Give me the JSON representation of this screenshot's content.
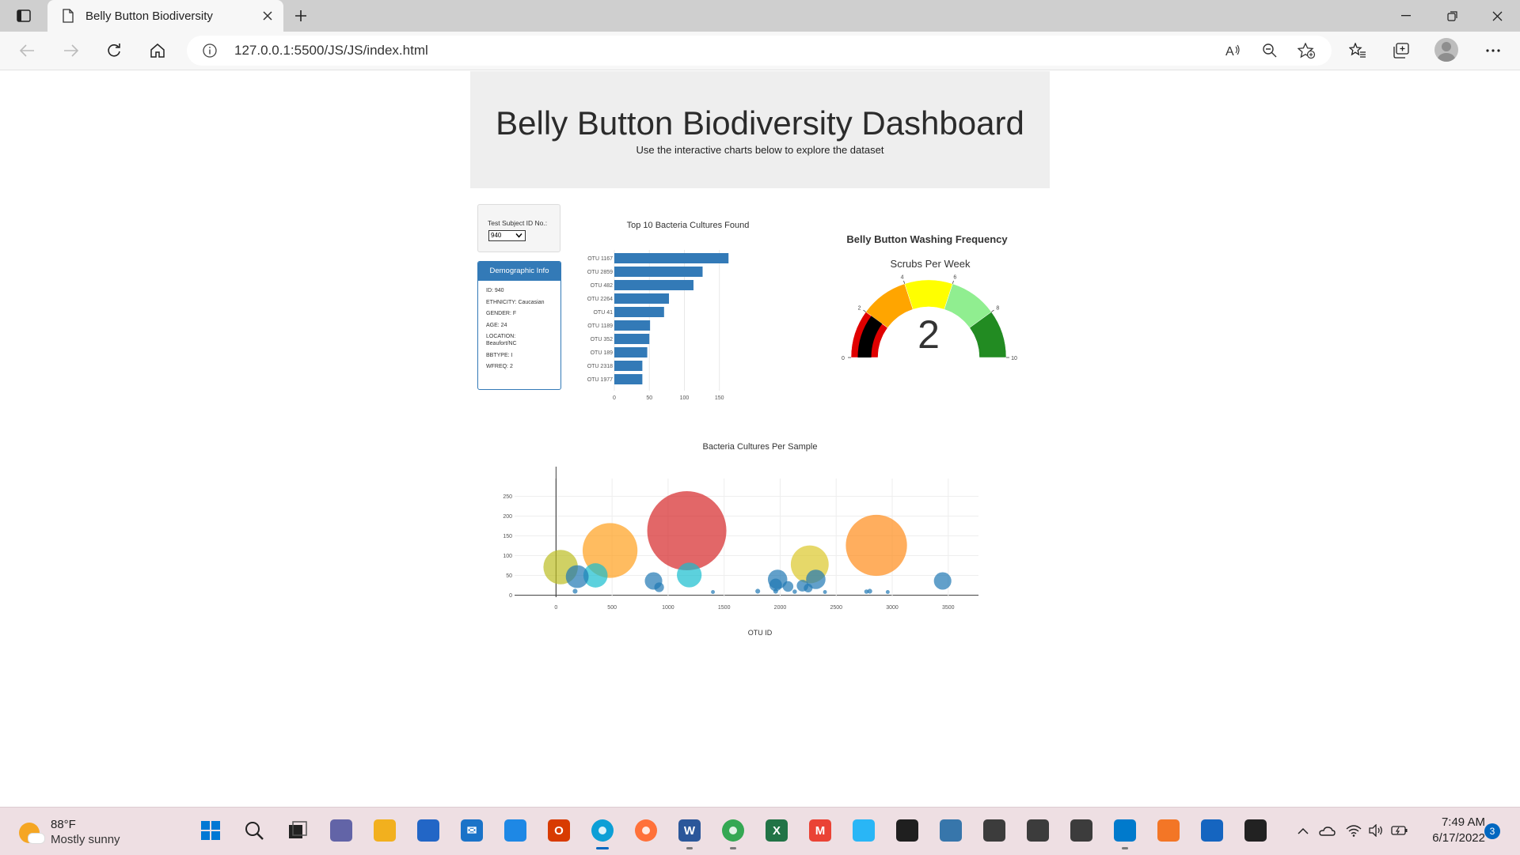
{
  "browser": {
    "tab_title": "Belly Button Biodiversity",
    "url_host": "127.0.0.1",
    "url_rest": ":5500/JS/JS/index.html"
  },
  "page": {
    "title": "Belly Button Biodiversity Dashboard",
    "subtitle": "Use the interactive charts below to explore the dataset",
    "select_label": "Test Subject ID No.:",
    "selected_id": "940",
    "demo_header": "Demographic Info",
    "demo_rows": [
      "ID: 940",
      "ETHNICITY: Caucasian",
      "GENDER: F",
      "AGE: 24",
      "LOCATION: Beaufort/NC",
      "BBTYPE: I",
      "WFREQ: 2"
    ]
  },
  "chart_data": [
    {
      "type": "bar",
      "orientation": "horizontal",
      "title": "Top 10 Bacteria Cultures Found",
      "categories": [
        "OTU 1167",
        "OTU 2859",
        "OTU 482",
        "OTU 2264",
        "OTU 41",
        "OTU 1189",
        "OTU 352",
        "OTU 189",
        "OTU 2318",
        "OTU 1977"
      ],
      "values": [
        163,
        126,
        113,
        78,
        71,
        51,
        50,
        47,
        40,
        40
      ],
      "xticks": [
        0,
        50,
        100,
        150
      ],
      "xlim": [
        0,
        165
      ],
      "color": "#337ab7"
    },
    {
      "type": "gauge",
      "title": "Belly Button Washing Frequency",
      "subtitle": "Scrubs Per Week",
      "value": 2,
      "range": [
        0,
        10
      ],
      "ticks": [
        0,
        2,
        4,
        6,
        8,
        10
      ],
      "bands": [
        {
          "from": 0,
          "to": 2,
          "color": "#e00000"
        },
        {
          "from": 2,
          "to": 4,
          "color": "#ffa500"
        },
        {
          "from": 4,
          "to": 6,
          "color": "#ffff00"
        },
        {
          "from": 6,
          "to": 8,
          "color": "#90ee90"
        },
        {
          "from": 8,
          "to": 10,
          "color": "#228b22"
        }
      ],
      "bar_color": "#000000"
    },
    {
      "type": "scatter",
      "subtype": "bubble",
      "title": "Bacteria Cultures Per Sample",
      "xlabel": "OTU ID",
      "xticks": [
        0,
        500,
        1000,
        1500,
        2000,
        2500,
        3000,
        3500
      ],
      "yticks": [
        0,
        50,
        100,
        150,
        200,
        250
      ],
      "xlim": [
        -370,
        3770
      ],
      "ylim": [
        -5,
        295
      ],
      "points": [
        {
          "x": 41,
          "y": 71,
          "color": "#bcbd22"
        },
        {
          "x": 189,
          "y": 47,
          "color": "#1f77b4"
        },
        {
          "x": 352,
          "y": 50,
          "color": "#17becf"
        },
        {
          "x": 482,
          "y": 113,
          "color": "#ff9f1c"
        },
        {
          "x": 1167,
          "y": 163,
          "color": "#d62728"
        },
        {
          "x": 1189,
          "y": 51,
          "color": "#17becf"
        },
        {
          "x": 870,
          "y": 36,
          "color": "#1f77b4"
        },
        {
          "x": 920,
          "y": 20,
          "color": "#1f77b4"
        },
        {
          "x": 1977,
          "y": 40,
          "color": "#1f77b4"
        },
        {
          "x": 1960,
          "y": 26,
          "color": "#1f77b4"
        },
        {
          "x": 2070,
          "y": 22,
          "color": "#1f77b4"
        },
        {
          "x": 2200,
          "y": 24,
          "color": "#1f77b4"
        },
        {
          "x": 2264,
          "y": 78,
          "color": "#dbc829"
        },
        {
          "x": 2318,
          "y": 40,
          "color": "#1f77b4"
        },
        {
          "x": 2250,
          "y": 18,
          "color": "#1f77b4"
        },
        {
          "x": 2859,
          "y": 126,
          "color": "#ff8c1a"
        },
        {
          "x": 3450,
          "y": 36,
          "color": "#1f77b4"
        },
        {
          "x": 170,
          "y": 10,
          "color": "#1f77b4"
        },
        {
          "x": 1400,
          "y": 8,
          "color": "#1f77b4"
        },
        {
          "x": 1800,
          "y": 10,
          "color": "#1f77b4"
        },
        {
          "x": 2400,
          "y": 8,
          "color": "#1f77b4"
        },
        {
          "x": 2770,
          "y": 9,
          "color": "#1f77b4"
        },
        {
          "x": 2800,
          "y": 10,
          "color": "#1f77b4"
        },
        {
          "x": 2960,
          "y": 8,
          "color": "#1f77b4"
        },
        {
          "x": 1960,
          "y": 10,
          "color": "#1f77b4"
        },
        {
          "x": 2130,
          "y": 9,
          "color": "#1f77b4"
        }
      ]
    }
  ],
  "taskbar": {
    "temp": "88°F",
    "condition": "Mostly sunny",
    "time": "7:49 AM",
    "date": "6/17/2022",
    "notifications": "3",
    "apps": [
      {
        "name": "start-icon",
        "color": "#0078d4"
      },
      {
        "name": "search-icon",
        "color": "#333333"
      },
      {
        "name": "task-view-icon",
        "color": "#333333"
      },
      {
        "name": "teams-chat-icon",
        "color": "#6264a7"
      },
      {
        "name": "file-explorer-icon",
        "color": "#f2b01e"
      },
      {
        "name": "microsoft-store-icon",
        "color": "#2266c6"
      },
      {
        "name": "mail-icon",
        "color": "#1a73c8"
      },
      {
        "name": "tool-icon",
        "color": "#1e88e5"
      },
      {
        "name": "office-icon",
        "color": "#d83b01"
      },
      {
        "name": "edge-icon",
        "color": "#0c9fd6"
      },
      {
        "name": "firefox-icon",
        "color": "#ff7139"
      },
      {
        "name": "word-icon",
        "color": "#2b579a"
      },
      {
        "name": "chrome-icon",
        "color": "#34a853"
      },
      {
        "name": "excel-icon",
        "color": "#217346"
      },
      {
        "name": "gmail-icon",
        "color": "#ea4335"
      },
      {
        "name": "paint-icon",
        "color": "#29b6f6"
      },
      {
        "name": "terminal-icon",
        "color": "#1f1f1f"
      },
      {
        "name": "python-icon",
        "color": "#3776ab"
      },
      {
        "name": "console-icon-1",
        "color": "#3c3c3c"
      },
      {
        "name": "console-icon-2",
        "color": "#3c3c3c"
      },
      {
        "name": "console-icon-3",
        "color": "#3c3c3c"
      },
      {
        "name": "vscode-icon",
        "color": "#007acc"
      },
      {
        "name": "jupyter-icon",
        "color": "#f37626"
      },
      {
        "name": "defender-icon",
        "color": "#1565c0"
      },
      {
        "name": "media-player-icon",
        "color": "#222222"
      }
    ]
  }
}
